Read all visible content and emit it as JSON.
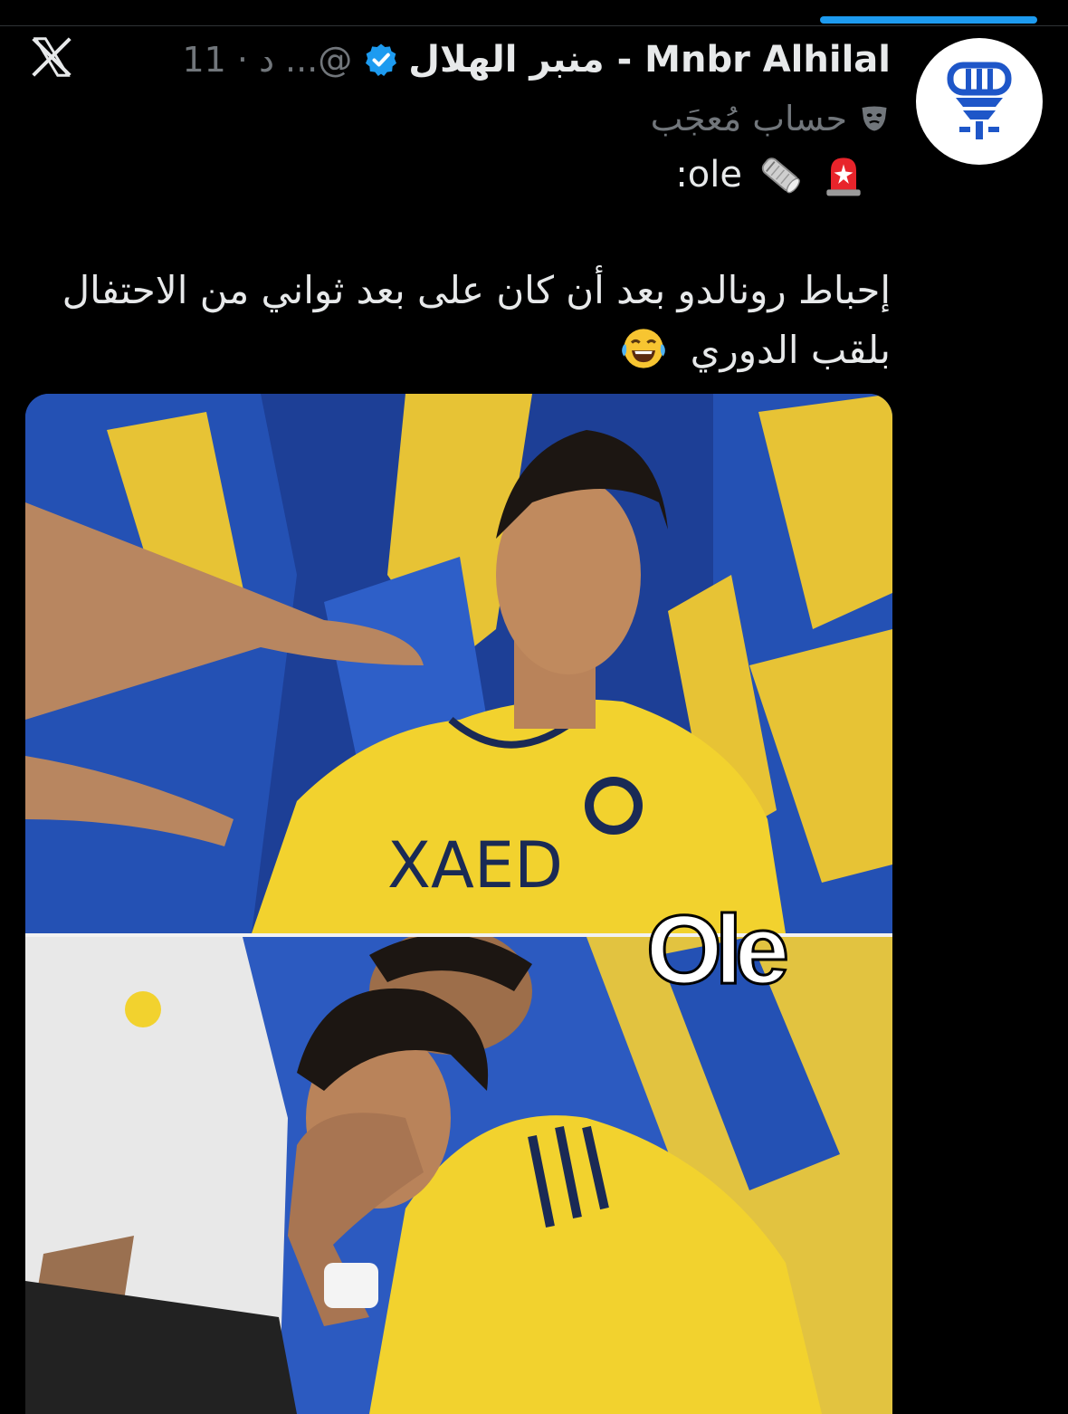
{
  "app": {
    "name": "X"
  },
  "tweet": {
    "display_name": "منبر الهلال - Mnbr Alhilal",
    "handle": "...@",
    "time": "11 · د",
    "parody_label": "حساب مُعجَب",
    "ole_label": ":ole",
    "body_line1": "إحباط رونالدو بعد أن كان على بعد ثواني من الاحتفال",
    "body_line2": "بلقب الدوري",
    "media_watermark": "Ole",
    "jersey_text": "XAED"
  },
  "colors": {
    "accent": "#1d9bf0",
    "background": "#000000",
    "text_primary": "#e7e9ea",
    "text_secondary": "#71767b",
    "jersey_yellow": "#f2d22e",
    "seat_blue": "#1f4aa8"
  },
  "icons": {
    "close": "x-logo-icon",
    "verified": "verified-badge-icon",
    "parody": "parody-mask-icon",
    "siren": "siren-emoji-icon",
    "newspaper": "rolled-newspaper-emoji-icon",
    "laugh": "tears-of-joy-emoji-icon"
  }
}
